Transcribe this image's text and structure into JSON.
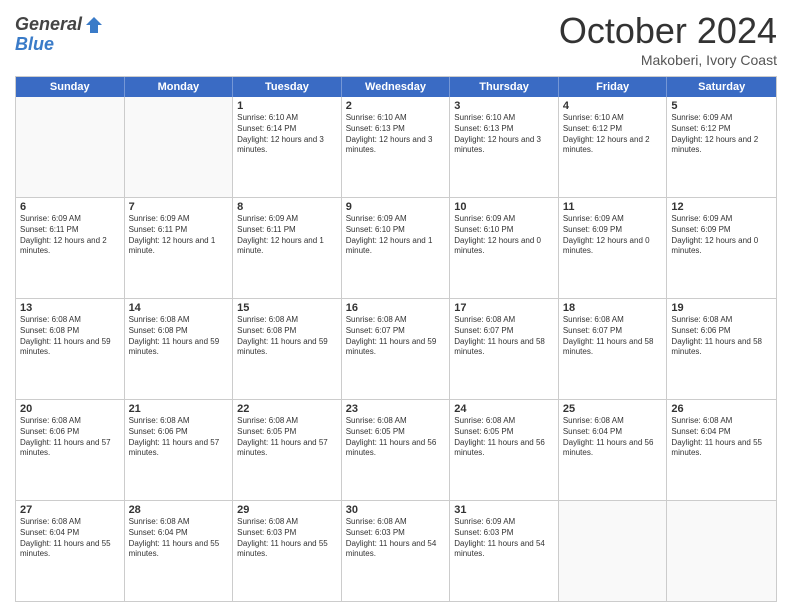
{
  "header": {
    "logo_line1": "General",
    "logo_line2": "Blue",
    "month": "October 2024",
    "location": "Makoberi, Ivory Coast"
  },
  "weekdays": [
    "Sunday",
    "Monday",
    "Tuesday",
    "Wednesday",
    "Thursday",
    "Friday",
    "Saturday"
  ],
  "weeks": [
    [
      {
        "day": "",
        "text": ""
      },
      {
        "day": "",
        "text": ""
      },
      {
        "day": "1",
        "text": "Sunrise: 6:10 AM\nSunset: 6:14 PM\nDaylight: 12 hours and 3 minutes."
      },
      {
        "day": "2",
        "text": "Sunrise: 6:10 AM\nSunset: 6:13 PM\nDaylight: 12 hours and 3 minutes."
      },
      {
        "day": "3",
        "text": "Sunrise: 6:10 AM\nSunset: 6:13 PM\nDaylight: 12 hours and 3 minutes."
      },
      {
        "day": "4",
        "text": "Sunrise: 6:10 AM\nSunset: 6:12 PM\nDaylight: 12 hours and 2 minutes."
      },
      {
        "day": "5",
        "text": "Sunrise: 6:09 AM\nSunset: 6:12 PM\nDaylight: 12 hours and 2 minutes."
      }
    ],
    [
      {
        "day": "6",
        "text": "Sunrise: 6:09 AM\nSunset: 6:11 PM\nDaylight: 12 hours and 2 minutes."
      },
      {
        "day": "7",
        "text": "Sunrise: 6:09 AM\nSunset: 6:11 PM\nDaylight: 12 hours and 1 minute."
      },
      {
        "day": "8",
        "text": "Sunrise: 6:09 AM\nSunset: 6:11 PM\nDaylight: 12 hours and 1 minute."
      },
      {
        "day": "9",
        "text": "Sunrise: 6:09 AM\nSunset: 6:10 PM\nDaylight: 12 hours and 1 minute."
      },
      {
        "day": "10",
        "text": "Sunrise: 6:09 AM\nSunset: 6:10 PM\nDaylight: 12 hours and 0 minutes."
      },
      {
        "day": "11",
        "text": "Sunrise: 6:09 AM\nSunset: 6:09 PM\nDaylight: 12 hours and 0 minutes."
      },
      {
        "day": "12",
        "text": "Sunrise: 6:09 AM\nSunset: 6:09 PM\nDaylight: 12 hours and 0 minutes."
      }
    ],
    [
      {
        "day": "13",
        "text": "Sunrise: 6:08 AM\nSunset: 6:08 PM\nDaylight: 11 hours and 59 minutes."
      },
      {
        "day": "14",
        "text": "Sunrise: 6:08 AM\nSunset: 6:08 PM\nDaylight: 11 hours and 59 minutes."
      },
      {
        "day": "15",
        "text": "Sunrise: 6:08 AM\nSunset: 6:08 PM\nDaylight: 11 hours and 59 minutes."
      },
      {
        "day": "16",
        "text": "Sunrise: 6:08 AM\nSunset: 6:07 PM\nDaylight: 11 hours and 59 minutes."
      },
      {
        "day": "17",
        "text": "Sunrise: 6:08 AM\nSunset: 6:07 PM\nDaylight: 11 hours and 58 minutes."
      },
      {
        "day": "18",
        "text": "Sunrise: 6:08 AM\nSunset: 6:07 PM\nDaylight: 11 hours and 58 minutes."
      },
      {
        "day": "19",
        "text": "Sunrise: 6:08 AM\nSunset: 6:06 PM\nDaylight: 11 hours and 58 minutes."
      }
    ],
    [
      {
        "day": "20",
        "text": "Sunrise: 6:08 AM\nSunset: 6:06 PM\nDaylight: 11 hours and 57 minutes."
      },
      {
        "day": "21",
        "text": "Sunrise: 6:08 AM\nSunset: 6:06 PM\nDaylight: 11 hours and 57 minutes."
      },
      {
        "day": "22",
        "text": "Sunrise: 6:08 AM\nSunset: 6:05 PM\nDaylight: 11 hours and 57 minutes."
      },
      {
        "day": "23",
        "text": "Sunrise: 6:08 AM\nSunset: 6:05 PM\nDaylight: 11 hours and 56 minutes."
      },
      {
        "day": "24",
        "text": "Sunrise: 6:08 AM\nSunset: 6:05 PM\nDaylight: 11 hours and 56 minutes."
      },
      {
        "day": "25",
        "text": "Sunrise: 6:08 AM\nSunset: 6:04 PM\nDaylight: 11 hours and 56 minutes."
      },
      {
        "day": "26",
        "text": "Sunrise: 6:08 AM\nSunset: 6:04 PM\nDaylight: 11 hours and 55 minutes."
      }
    ],
    [
      {
        "day": "27",
        "text": "Sunrise: 6:08 AM\nSunset: 6:04 PM\nDaylight: 11 hours and 55 minutes."
      },
      {
        "day": "28",
        "text": "Sunrise: 6:08 AM\nSunset: 6:04 PM\nDaylight: 11 hours and 55 minutes."
      },
      {
        "day": "29",
        "text": "Sunrise: 6:08 AM\nSunset: 6:03 PM\nDaylight: 11 hours and 55 minutes."
      },
      {
        "day": "30",
        "text": "Sunrise: 6:08 AM\nSunset: 6:03 PM\nDaylight: 11 hours and 54 minutes."
      },
      {
        "day": "31",
        "text": "Sunrise: 6:09 AM\nSunset: 6:03 PM\nDaylight: 11 hours and 54 minutes."
      },
      {
        "day": "",
        "text": ""
      },
      {
        "day": "",
        "text": ""
      }
    ]
  ]
}
